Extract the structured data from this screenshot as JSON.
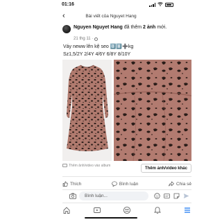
{
  "status_bar": {
    "time": "01:16"
  },
  "nav": {
    "back_icon": "chevron-left-icon",
    "title": "Bài viết của Nguyet Hang"
  },
  "post": {
    "author": "Nguyen Nguyet Hang",
    "action_text": "đã thêm",
    "photo_count": "2 ảnh",
    "action_suffix": "mới.",
    "time": "21 thg 11 ·",
    "privacy_icon": "globe-icon",
    "more_icon": "more-horizontal-icon",
    "text_line1": "Váy neww lên kệ seo 0️⃣8️⃣➕kg",
    "text_line2": "Sz1,5/2Y  2/4Y  4/6Y  6/8Y  8/10Y"
  },
  "photos": [
    {
      "name": "dress-front-photo",
      "description_icon": "photo-icon"
    },
    {
      "name": "fabric-closeup-photo",
      "description_icon": "photo-icon"
    }
  ],
  "album": {
    "label": "Thêm ảnh/video vào album",
    "button": "Thêm ảnh/video khác"
  },
  "actions": {
    "like": "Thích",
    "comment": "Bình luận",
    "share": "Chia sẻ"
  },
  "comment_bar": {
    "placeholder": "Bình luận..."
  },
  "tabbar": {
    "items": [
      "home-icon",
      "watch-icon",
      "people-icon",
      "notifications-icon",
      "menu-icon"
    ],
    "active_index": 4
  },
  "colors": {
    "accent": "#1877f2",
    "dress": "#b07a6e",
    "fabric": "#b27b70",
    "spot": "#2a1c18"
  }
}
